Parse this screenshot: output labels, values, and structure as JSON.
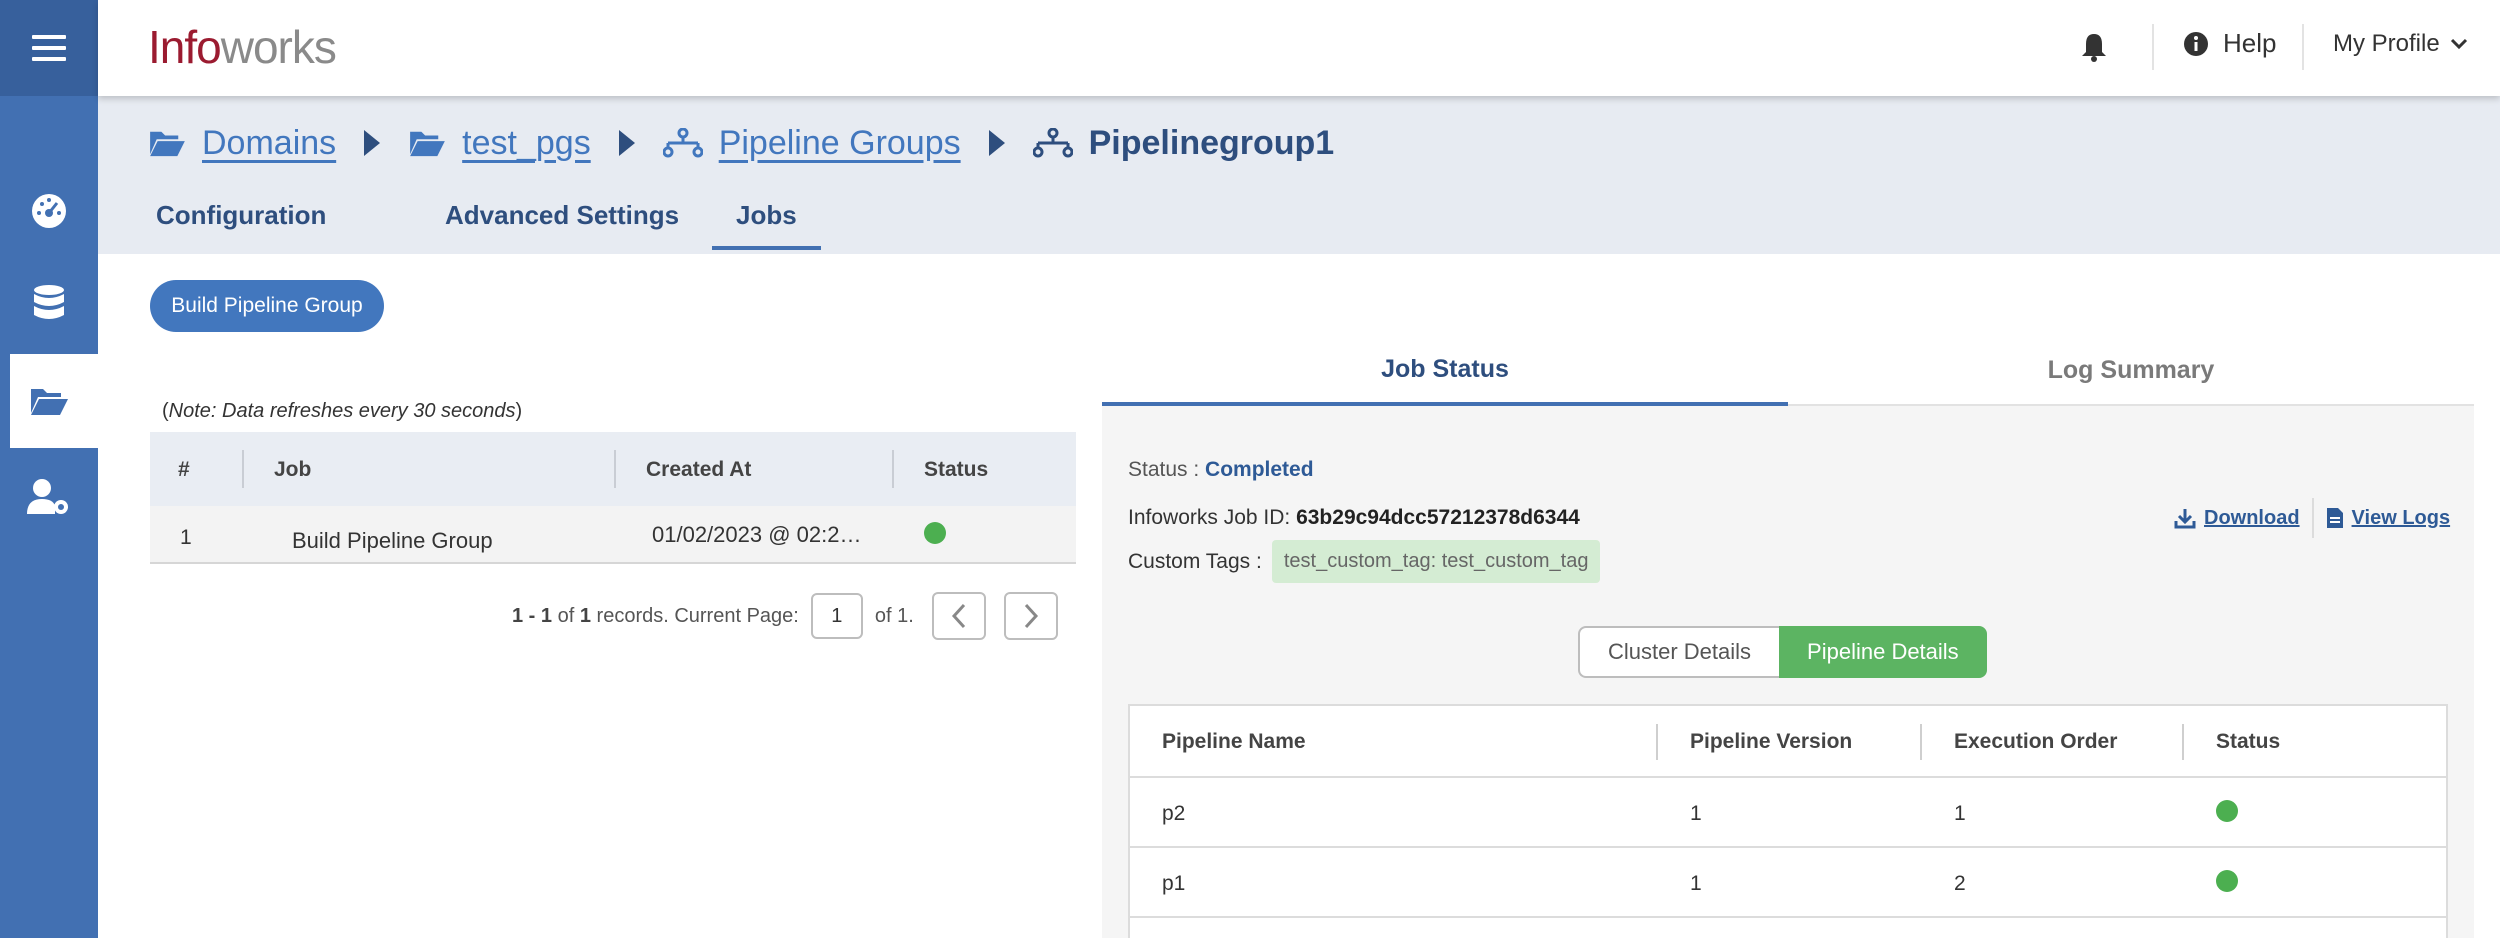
{
  "header": {
    "logo_part1": "Info",
    "logo_part2": "works",
    "help_label": "Help",
    "profile_label": "My Profile"
  },
  "sidebar": {
    "items": [
      {
        "icon": "dashboard-icon"
      },
      {
        "icon": "database-icon"
      },
      {
        "icon": "folder-open-icon",
        "active": true
      },
      {
        "icon": "user-settings-icon"
      }
    ]
  },
  "breadcrumb": {
    "items": [
      {
        "label": "Domains",
        "icon": "folder-open-icon"
      },
      {
        "label": "test_pgs",
        "icon": "folder-open-icon"
      },
      {
        "label": "Pipeline Groups",
        "icon": "pipeline-icon"
      }
    ],
    "current": "Pipelinegroup1"
  },
  "tabs": [
    {
      "label": "Configuration"
    },
    {
      "label": "Advanced Settings"
    },
    {
      "label": "Jobs",
      "active": true
    }
  ],
  "build_button": "Build Pipeline Group",
  "jobs": {
    "note_paren_open": "(",
    "note_text": "Note: Data refreshes every 30 seconds",
    "note_paren_close": ")",
    "columns": [
      "#",
      "Job",
      "Created At",
      "Status"
    ],
    "rows": [
      {
        "num": "1",
        "job": "Build Pipeline Group",
        "created": "01/02/2023 @ 02:2…",
        "status": "success"
      }
    ],
    "pager": {
      "range": "1 - 1",
      "of_label": "of",
      "total": "1",
      "records_label": "records. Current Page:",
      "current_page": "1",
      "of_pages": "of 1."
    }
  },
  "right_tabs": [
    {
      "label": "Job Status",
      "active": true
    },
    {
      "label": "Log Summary"
    }
  ],
  "job_status": {
    "status_label": "Status :",
    "status_value": "Completed",
    "job_id_label": "Infoworks Job ID:",
    "job_id_value": "63b29c94dcc57212378d6344",
    "custom_tags_label": "Custom Tags :",
    "custom_tag": "test_custom_tag: test_custom_tag",
    "download_label": "Download",
    "view_logs_label": "View Logs",
    "toggle": {
      "cluster": "Cluster Details",
      "pipeline": "Pipeline Details"
    },
    "pipeline_columns": [
      "Pipeline Name",
      "Pipeline Version",
      "Execution Order",
      "Status"
    ],
    "pipelines": [
      {
        "name": "p2",
        "version": "1",
        "order": "1",
        "status": "success"
      },
      {
        "name": "p1",
        "version": "1",
        "order": "2",
        "status": "success"
      }
    ]
  },
  "colors": {
    "sidebar": "#4270b2",
    "accent": "#4277be",
    "success": "#4caf50",
    "toggle_on": "#5cb462"
  }
}
